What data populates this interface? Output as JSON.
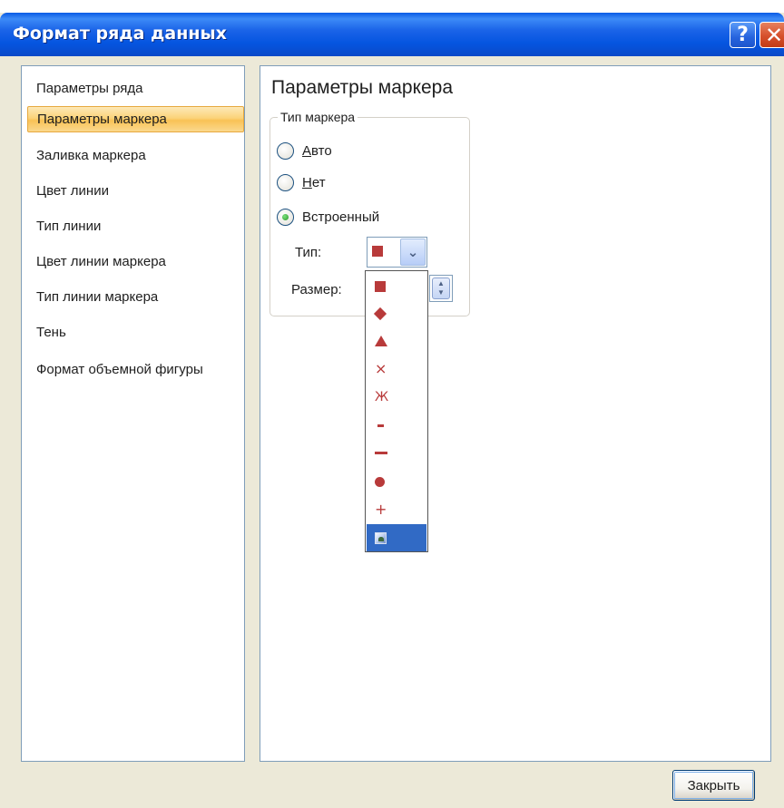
{
  "window": {
    "title": "Формат ряда данных",
    "help_label": "?",
    "close_label": "✕"
  },
  "nav": {
    "items": [
      {
        "label": "Параметры ряда"
      },
      {
        "label": "Параметры маркера",
        "selected": true
      },
      {
        "label": "Заливка маркера"
      },
      {
        "label": "Цвет линии"
      },
      {
        "label": "Тип линии"
      },
      {
        "label": "Цвет линии маркера"
      },
      {
        "label": "Тип линии маркера"
      },
      {
        "label": "Тень"
      },
      {
        "label": "Формат объемной фигуры"
      }
    ]
  },
  "panel": {
    "title": "Параметры маркера",
    "marker_type_group": "Тип маркера",
    "radio_auto_underlined": "А",
    "radio_auto_rest": "вто",
    "radio_none_underlined": "Н",
    "radio_none_rest": "ет",
    "radio_builtin": "Встроенный",
    "selected_radio": "builtin",
    "type_label": "Тип:",
    "size_label": "Размер:"
  },
  "dropdown": {
    "marker_color": "#b83a3a",
    "selection_color": "#316ac5",
    "options": [
      {
        "icon": "square-marker-icon"
      },
      {
        "icon": "diamond-marker-icon"
      },
      {
        "icon": "triangle-marker-icon"
      },
      {
        "icon": "x-marker-icon",
        "glyph": "×"
      },
      {
        "icon": "star-marker-icon",
        "glyph": "Ж"
      },
      {
        "icon": "short-dash-marker-icon"
      },
      {
        "icon": "long-dash-marker-icon"
      },
      {
        "icon": "circle-marker-icon"
      },
      {
        "icon": "plus-marker-icon",
        "glyph": "+"
      },
      {
        "icon": "picture-marker-icon",
        "selected": true
      }
    ]
  },
  "footer": {
    "close_button": "Закрыть"
  }
}
